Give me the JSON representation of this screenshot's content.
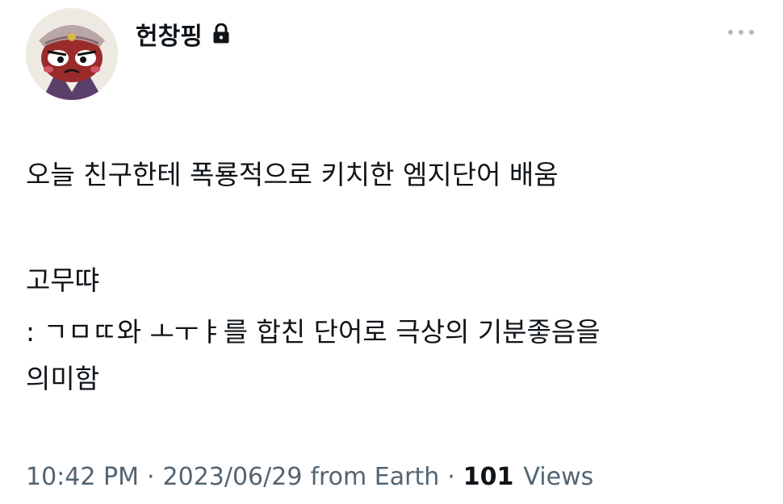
{
  "tweet": {
    "display_name": "헌창핑",
    "protected_icon": "lock-icon",
    "more_icon": "more-horizontal-icon",
    "avatar_icon": "cartoon-character-avatar",
    "text_lines": [
      "오늘 친구한테 폭룡적으로 키치한 엠지단어 배움",
      "고무땨",
      ": ㄱㅁㄸ와 ㅗㅜㅑ를 합친 단어로 극상의 기분좋음을",
      "의미함"
    ],
    "time": "10:42 PM",
    "separator": "·",
    "date": "2023/06/29",
    "source": "from Earth",
    "views_count": "101",
    "views_label": "Views"
  },
  "colors": {
    "text_primary": "#0f1419",
    "text_secondary": "#536471",
    "background": "#ffffff"
  }
}
